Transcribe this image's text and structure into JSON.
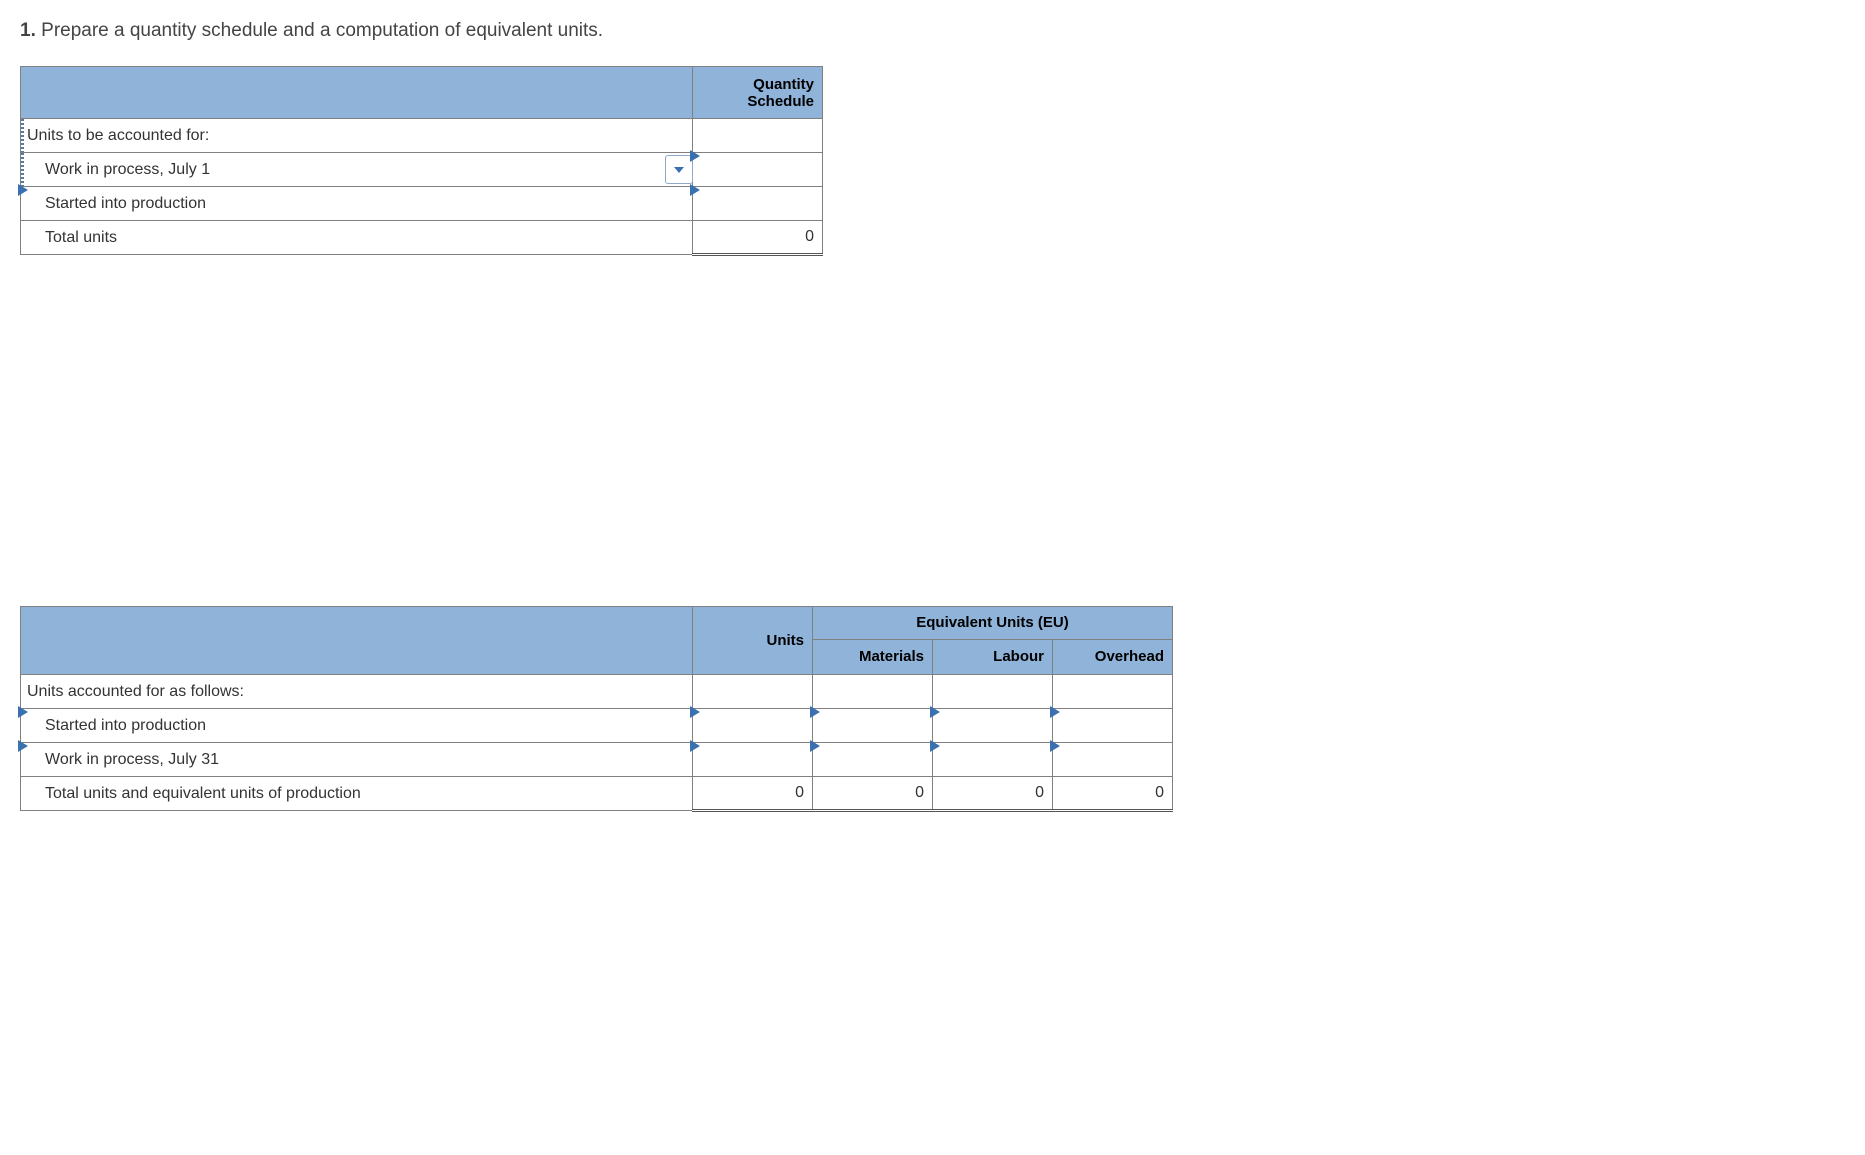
{
  "instruction": {
    "number": "1.",
    "text": "Prepare a quantity schedule and a computation of equivalent units."
  },
  "table1": {
    "header": "Quantity Schedule",
    "rows": {
      "section": "Units to be accounted for:",
      "wip": "Work in process, July 1",
      "started": "Started into production",
      "total": "Total units"
    },
    "values": {
      "wip": "",
      "started": "",
      "total": "0"
    }
  },
  "table2": {
    "group_header": "Equivalent Units (EU)",
    "headers": {
      "units": "Units",
      "materials": "Materials",
      "labour": "Labour",
      "overhead": "Overhead"
    },
    "rows": {
      "section": "Units accounted for as follows:",
      "started": "Started into production",
      "wip": "Work in process, July 31",
      "total": "Total units and equivalent units of production"
    },
    "values": {
      "started": {
        "units": "",
        "materials": "",
        "labour": "",
        "overhead": ""
      },
      "wip": {
        "units": "",
        "materials": "",
        "labour": "",
        "overhead": ""
      },
      "total": {
        "units": "0",
        "materials": "0",
        "labour": "0",
        "overhead": "0"
      }
    }
  }
}
